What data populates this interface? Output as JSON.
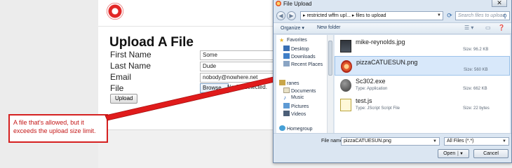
{
  "webpage": {
    "title": "Upload A File",
    "fields": [
      {
        "label": "First Name",
        "value": "Some"
      },
      {
        "label": "Last Name",
        "value": "Dude"
      },
      {
        "label": "Email",
        "value": "nobody@nowhere.net"
      }
    ],
    "file_label": "File",
    "browse_label": "Browse...",
    "no_file_text": "No file selected.",
    "upload_label": "Upload"
  },
  "callout": {
    "text": "A file that's allowed, but it exceeds the upload size limit.",
    "color": "#d52020"
  },
  "dialog": {
    "title": "File Upload",
    "close_label": "✕",
    "address": "▸ restricted wffm upl... ▸ files to upload",
    "search_placeholder": "Search files to upload",
    "toolbar": {
      "organize": "Organize ▾",
      "new_folder": "New folder"
    },
    "nav": [
      {
        "label": "Favorites",
        "icon": "star-icon"
      },
      {
        "label": "Desktop",
        "icon": "desktop-icon"
      },
      {
        "label": "Downloads",
        "icon": "downloads-icon"
      },
      {
        "label": "Recent Places",
        "icon": "recent-places-icon"
      },
      {
        "label": "ranes",
        "icon": "libraries-icon"
      },
      {
        "label": "Documents",
        "icon": "documents-icon"
      },
      {
        "label": "Music",
        "icon": "music-icon"
      },
      {
        "label": "Pictures",
        "icon": "pictures-icon"
      },
      {
        "label": "Videos",
        "icon": "videos-icon"
      },
      {
        "label": "Homegroup",
        "icon": "homegroup-icon"
      }
    ],
    "files": [
      {
        "name": "mike-reynolds.jpg",
        "type": "",
        "size": "Size: 96.2 KB"
      },
      {
        "name": "pizzaCATUESUN.png",
        "type": "",
        "size": "Size: 560 KB"
      },
      {
        "name": "Sc302.exe",
        "type": "Type: Application",
        "size": "Size: 662 KB"
      },
      {
        "name": "test.js",
        "type": "Type: JScript Script File",
        "size": "Size: 22 bytes"
      }
    ],
    "file_name_label": "File name:",
    "file_name_value": "pizzaCATUESUN.png",
    "filter_value": "All Files (*.*)",
    "open_label": "Open",
    "cancel_label": "Cancel"
  }
}
